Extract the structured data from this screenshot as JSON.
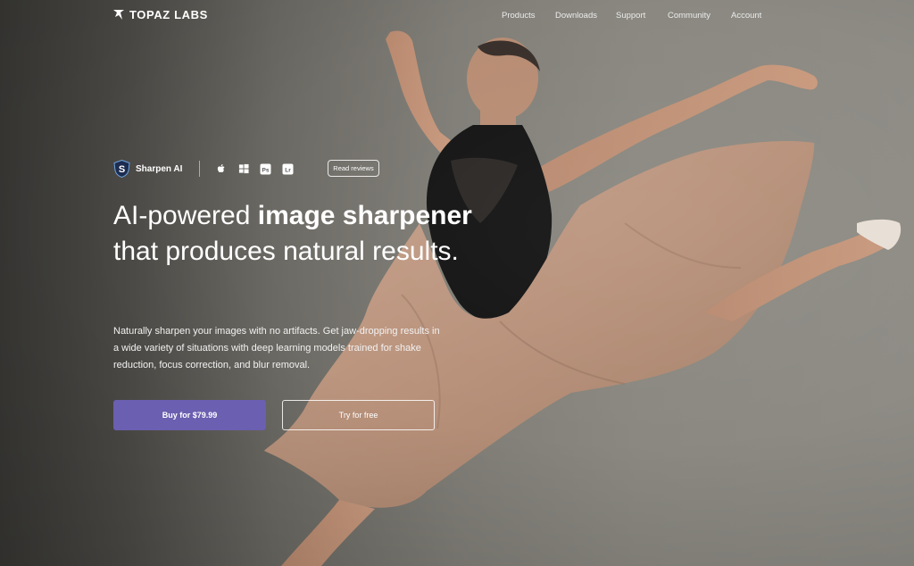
{
  "brand": {
    "name": "TOPAZ LABS",
    "accent_color": "#6a5fb0"
  },
  "nav": {
    "items": [
      {
        "label": "Products"
      },
      {
        "label": "Downloads"
      },
      {
        "label": "Support"
      },
      {
        "label": "Community"
      },
      {
        "label": "Account"
      }
    ]
  },
  "product": {
    "name": "Sharpen AI",
    "icon": "sharpen-ai-shield-icon",
    "platforms": [
      "apple-icon",
      "windows-icon",
      "photoshop-icon",
      "lightroom-icon"
    ],
    "photoshop_abbr": "Ps",
    "lightroom_abbr": "Lr",
    "reviews_label": "Read reviews"
  },
  "hero": {
    "headline_part1": "AI-powered ",
    "headline_bold1": "image sharpener",
    "headline_part2": " that produces natural results.",
    "subhead": "Naturally sharpen your images with no artifacts. Get jaw-dropping results in a wide variety of situations with deep learning models trained for shake reduction, focus correction, and blur removal.",
    "buy_label": "Buy for $79.99",
    "try_label": "Try for free"
  }
}
